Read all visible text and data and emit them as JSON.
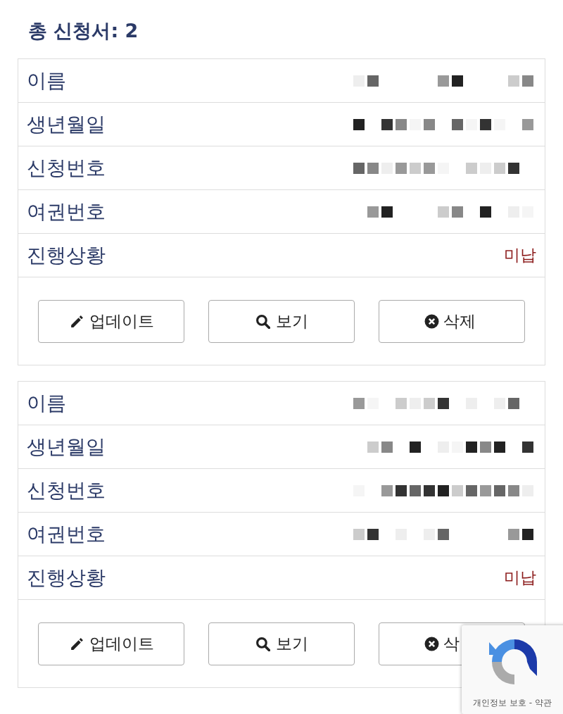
{
  "title": "총 신청서: 2",
  "applications": [
    {
      "rows": [
        {
          "label": "이름",
          "kind": "redacted"
        },
        {
          "label": "생년월일",
          "kind": "redacted"
        },
        {
          "label": "신청번호",
          "kind": "redacted"
        },
        {
          "label": "여권번호",
          "kind": "redacted"
        },
        {
          "label": "진행상황",
          "kind": "status",
          "value": "미납"
        }
      ],
      "buttons": [
        {
          "label": "업데이트",
          "kind": "update"
        },
        {
          "label": "보기",
          "kind": "view"
        },
        {
          "label": "삭제",
          "kind": "delete"
        }
      ]
    },
    {
      "rows": [
        {
          "label": "이름",
          "kind": "redacted"
        },
        {
          "label": "생년월일",
          "kind": "redacted"
        },
        {
          "label": "신청번호",
          "kind": "redacted"
        },
        {
          "label": "여권번호",
          "kind": "redacted"
        },
        {
          "label": "진행상황",
          "kind": "status",
          "value": "미납"
        }
      ],
      "buttons": [
        {
          "label": "업데이트",
          "kind": "update"
        },
        {
          "label": "보기",
          "kind": "view"
        },
        {
          "label": "삭",
          "kind": "delete"
        }
      ]
    }
  ],
  "recaptcha": {
    "links": "개인정보 보호 - 약관"
  }
}
